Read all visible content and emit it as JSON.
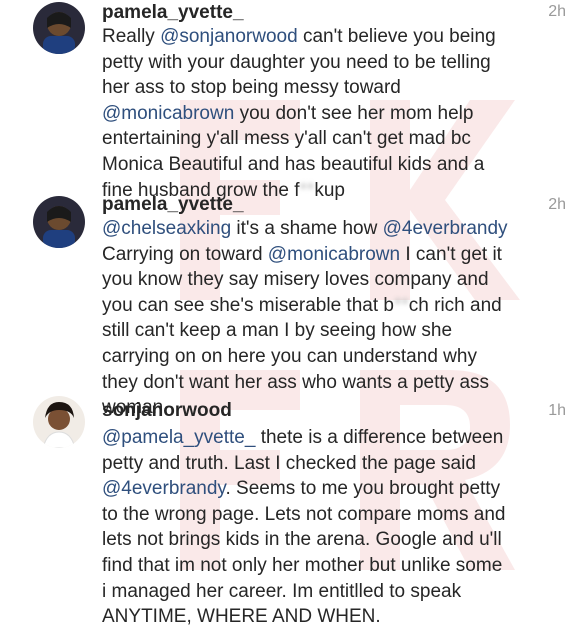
{
  "comments": [
    {
      "username": "pamela_yvette_",
      "time": "2h",
      "avatar": "avatar-pamela",
      "lines": [
        [
          "Really ",
          "@sonjanorwood",
          " can't believe you being"
        ],
        [
          "petty with your daughter you need to be telling"
        ],
        [
          "her ass to stop being messy toward"
        ],
        [
          "@monicabrown",
          " you don't see her mom help"
        ],
        [
          "entertaining y'all mess y'all can't get mad bc"
        ],
        [
          "Monica Beautiful and has beautiful kids and a"
        ],
        [
          "fine husband grow the f",
          "**",
          "kup"
        ]
      ]
    },
    {
      "username": "pamela_yvette_",
      "time": "2h",
      "avatar": "avatar-pamela",
      "lines": [
        [
          "@chelseaxking",
          " it's a shame how ",
          "@4everbrandy"
        ],
        [
          "Carrying on toward ",
          "@monicabrown",
          " I can't get it"
        ],
        [
          "you know they say misery loves company and"
        ],
        [
          "you can see she's miserable that b",
          "**",
          "ch rich and"
        ],
        [
          "still can't keep a man I by seeing how she"
        ],
        [
          "carrying on on here you can understand why"
        ],
        [
          "they don't want her ass who wants a petty ass"
        ],
        [
          "woman"
        ]
      ]
    },
    {
      "username": "sonjanorwood",
      "time": "1h",
      "avatar": "avatar-sonja",
      "lines": [
        [
          "@pamela_yvette_",
          " thete is a difference between"
        ],
        [
          "petty and truth. Last I checked the page said"
        ],
        [
          "@4everbrandy",
          ". Seems to me you brought petty"
        ],
        [
          "to the wrong page. Lets not compare moms and"
        ],
        [
          "lets not brings kids in the arena. Google and u'll"
        ],
        [
          "find that im not only her mother but unlike some"
        ],
        [
          "i managed her career. Im entitlled to speak"
        ],
        [
          "ANYTIME, WHERE AND WHEN."
        ]
      ]
    }
  ],
  "colors": {
    "text": "#262626",
    "mention": "#2f4f7d",
    "time": "#9a9a9a",
    "watermark": "#d32f2f"
  }
}
